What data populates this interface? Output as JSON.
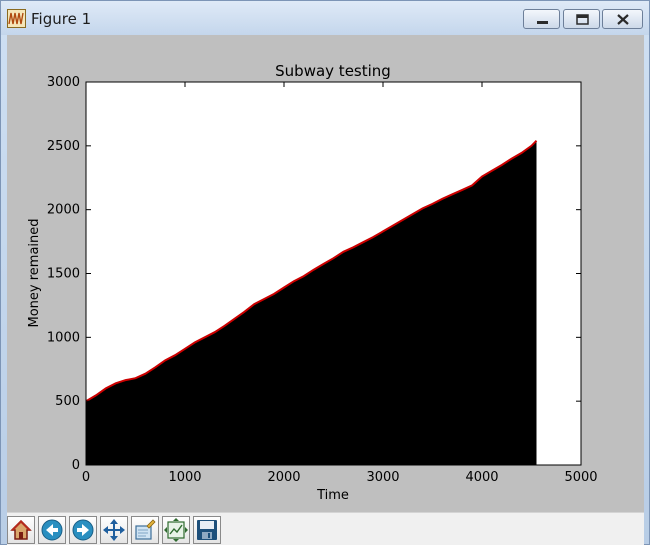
{
  "window": {
    "title": "Figure 1",
    "icon": "matplotlib-wave-icon",
    "controls": [
      "minimize-icon",
      "maximize-icon",
      "close-icon"
    ]
  },
  "colors": {
    "figure_background": "#bfbfbf",
    "axes_background": "#ffffff",
    "fill": "#000000",
    "line": "#cc0000"
  },
  "chart_data": {
    "type": "area",
    "title": "Subway testing",
    "xlabel": "Time",
    "ylabel": "Money remained",
    "xlim": [
      0,
      5000
    ],
    "ylim": [
      0,
      3000
    ],
    "xticks": [
      "0",
      "1000",
      "2000",
      "3000",
      "4000",
      "5000"
    ],
    "yticks": [
      "0",
      "500",
      "1000",
      "1500",
      "2000",
      "2500",
      "3000"
    ],
    "grid": false,
    "legend": false,
    "series": [
      {
        "style": "red line over black filled area",
        "x": [
          0,
          100,
          200,
          300,
          400,
          500,
          600,
          700,
          800,
          900,
          1000,
          1100,
          1200,
          1300,
          1400,
          1500,
          1600,
          1700,
          1800,
          1900,
          2000,
          2100,
          2200,
          2300,
          2400,
          2500,
          2600,
          2700,
          2800,
          2900,
          3000,
          3100,
          3200,
          3300,
          3400,
          3500,
          3600,
          3700,
          3800,
          3900,
          4000,
          4100,
          4200,
          4300,
          4400,
          4500,
          4550
        ],
        "y": [
          500,
          545,
          600,
          640,
          665,
          680,
          715,
          765,
          820,
          860,
          910,
          960,
          1000,
          1040,
          1090,
          1145,
          1200,
          1260,
          1300,
          1340,
          1390,
          1440,
          1480,
          1530,
          1575,
          1620,
          1670,
          1705,
          1745,
          1785,
          1830,
          1875,
          1920,
          1965,
          2010,
          2045,
          2085,
          2120,
          2155,
          2190,
          2260,
          2305,
          2350,
          2400,
          2445,
          2500,
          2540
        ]
      }
    ]
  },
  "toolbar": {
    "buttons": [
      {
        "name": "home",
        "icon": "home-icon"
      },
      {
        "name": "back",
        "icon": "back-arrow-icon"
      },
      {
        "name": "forward",
        "icon": "forward-arrow-icon"
      },
      {
        "name": "pan",
        "icon": "pan-arrows-icon"
      },
      {
        "name": "zoom",
        "icon": "zoom-rect-icon"
      },
      {
        "name": "subplots",
        "icon": "subplots-icon"
      },
      {
        "name": "save",
        "icon": "save-disk-icon"
      }
    ]
  }
}
